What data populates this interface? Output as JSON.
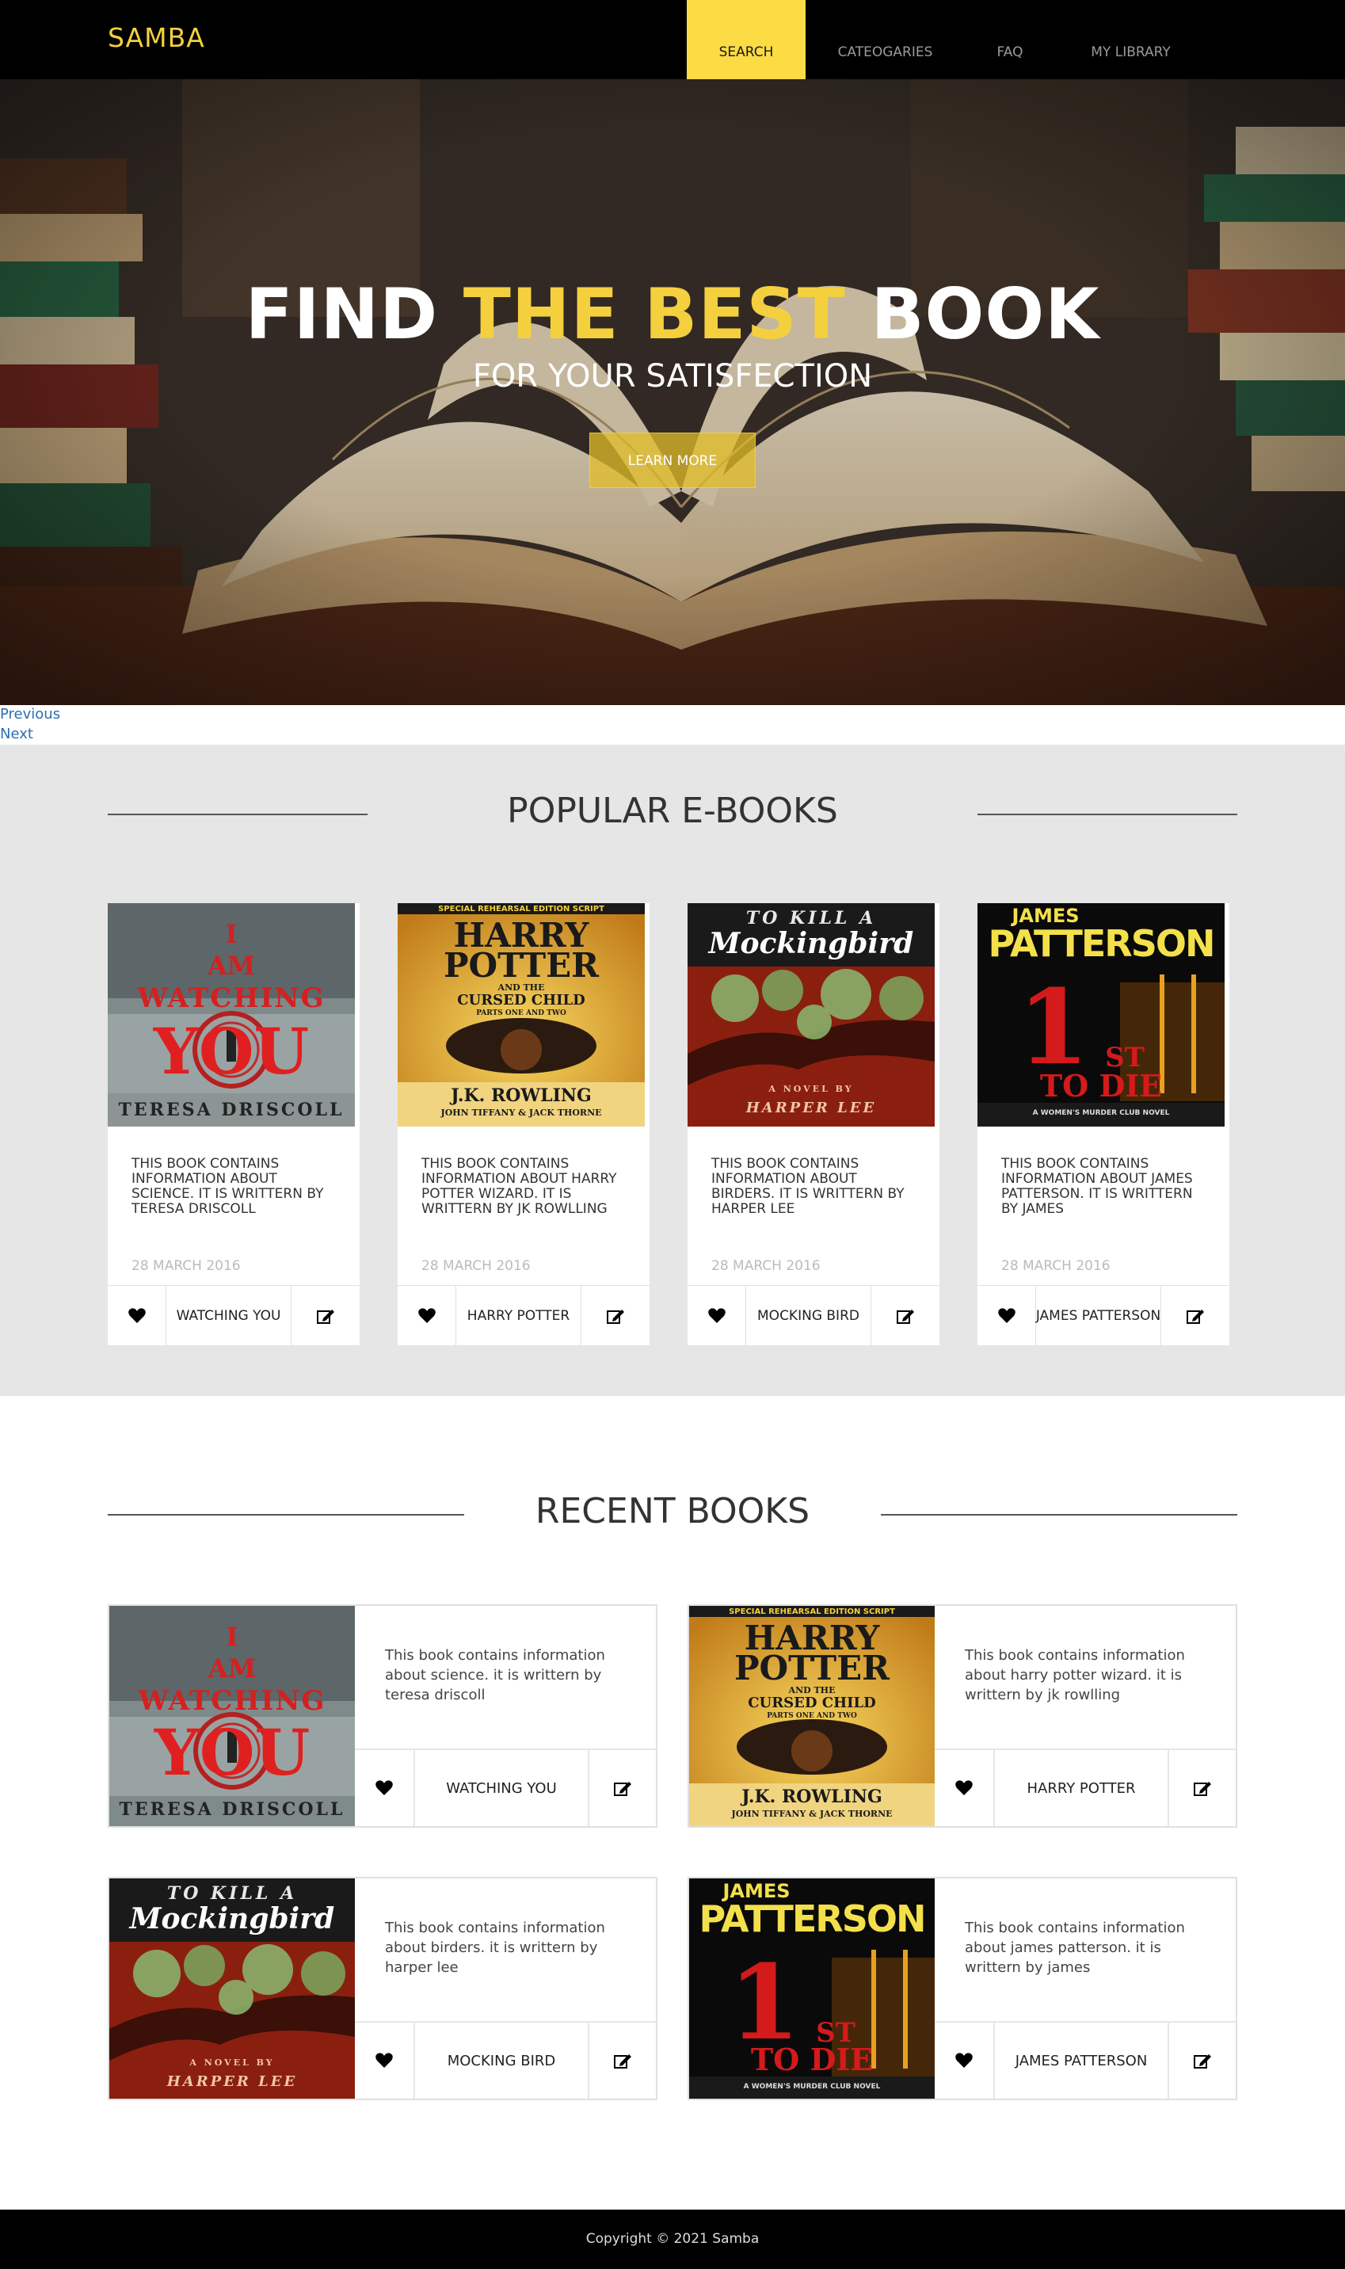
{
  "nav": {
    "brand": "SAMBA",
    "items": [
      {
        "label": "SEARCH",
        "active": true
      },
      {
        "label": "CATEOGARIES",
        "active": false
      },
      {
        "label": "FAQ",
        "active": false
      },
      {
        "label": "MY LIBRARY",
        "active": false
      }
    ]
  },
  "hero": {
    "title_part1": "FIND ",
    "title_highlight": "THE BEST",
    "title_part2": " BOOK",
    "subtitle": "FOR YOUR SATISFECTION",
    "button": "LEARN MORE",
    "previous": "Previous",
    "next": "Next"
  },
  "popular": {
    "title": "POPULAR E-BOOKS",
    "cards": [
      {
        "desc": "THIS BOOK CONTAINS INFORMATION ABOUT SCIENCE. IT IS WRITTERN BY TERESA DRISCOLL",
        "date": "28 MARCH 2016",
        "name": "WATCHING YOU"
      },
      {
        "desc": "THIS BOOK CONTAINS INFORMATION ABOUT HARRY POTTER WIZARD. IT IS WRITTERN BY JK ROWLLING",
        "date": "28 MARCH 2016",
        "name": "HARRY POTTER"
      },
      {
        "desc": "THIS BOOK CONTAINS INFORMATION ABOUT BIRDERS. IT IS WRITTERN BY HARPER LEE",
        "date": "28 MARCH 2016",
        "name": "MOCKING BIRD"
      },
      {
        "desc": "THIS BOOK CONTAINS INFORMATION ABOUT JAMES PATTERSON. IT IS WRITTERN BY JAMES",
        "date": "28 MARCH 2016",
        "name": "JAMES PATTERSON"
      }
    ]
  },
  "recent": {
    "title": "RECENT BOOKS",
    "cards": [
      {
        "desc": "This book contains information about science. it is writtern by teresa driscoll",
        "name": "WATCHING YOU"
      },
      {
        "desc": "This book contains information about harry potter wizard. it is writtern by jk rowlling",
        "name": "HARRY POTTER"
      },
      {
        "desc": "This book contains information about birders. it is writtern by harper lee",
        "name": "MOCKING BIRD"
      },
      {
        "desc": "This book contains information about james patterson. it is writtern by james",
        "name": "JAMES PATTERSON"
      }
    ]
  },
  "covers": {
    "watching": {
      "line1": "I",
      "line2": "AM",
      "line3": "WATCHING",
      "line4": "YOU",
      "author": "TERESA DRISCOLL"
    },
    "potter": {
      "top": "SPECIAL REHEARSAL EDITION SCRIPT",
      "title1": "HARRY",
      "title2": "POTTER",
      "sub1": "AND THE",
      "sub2": "CURSED CHILD",
      "sub3": "PARTS ONE AND TWO",
      "author": "J.K. ROWLING",
      "author2": "JOHN TIFFANY & JACK THORNE"
    },
    "mocking": {
      "line1": "TO KILL A",
      "line2": "Mockingbird",
      "novel": "A NOVEL BY",
      "author": "HARPER LEE"
    },
    "patterson": {
      "author1": "JAMES",
      "author2": "PATTERSON",
      "big": "1",
      "st": "ST",
      "todie": "TO DIE",
      "series": "A WOMEN'S MURDER CLUB NOVEL"
    }
  },
  "footer": {
    "text": "Copyright © 2021 Samba"
  },
  "icons": {
    "heart": "heart-icon",
    "edit": "edit-icon"
  },
  "colors": {
    "accent": "#fbdc45",
    "nav_bg": "#000000",
    "section_bg": "#e6e6e6"
  }
}
